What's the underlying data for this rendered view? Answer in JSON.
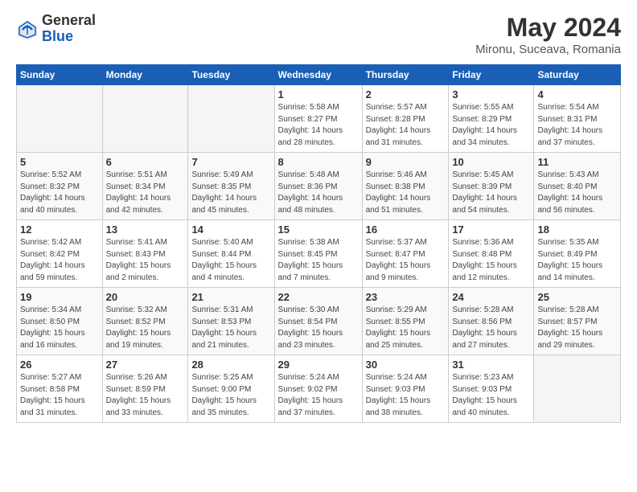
{
  "header": {
    "logo_general": "General",
    "logo_blue": "Blue",
    "month_year": "May 2024",
    "location": "Mironu, Suceava, Romania"
  },
  "days_of_week": [
    "Sunday",
    "Monday",
    "Tuesday",
    "Wednesday",
    "Thursday",
    "Friday",
    "Saturday"
  ],
  "weeks": [
    [
      {
        "day": "",
        "empty": true
      },
      {
        "day": "",
        "empty": true
      },
      {
        "day": "",
        "empty": true
      },
      {
        "day": "1",
        "info": "Sunrise: 5:58 AM\nSunset: 8:27 PM\nDaylight: 14 hours\nand 28 minutes."
      },
      {
        "day": "2",
        "info": "Sunrise: 5:57 AM\nSunset: 8:28 PM\nDaylight: 14 hours\nand 31 minutes."
      },
      {
        "day": "3",
        "info": "Sunrise: 5:55 AM\nSunset: 8:29 PM\nDaylight: 14 hours\nand 34 minutes."
      },
      {
        "day": "4",
        "info": "Sunrise: 5:54 AM\nSunset: 8:31 PM\nDaylight: 14 hours\nand 37 minutes."
      }
    ],
    [
      {
        "day": "5",
        "info": "Sunrise: 5:52 AM\nSunset: 8:32 PM\nDaylight: 14 hours\nand 40 minutes."
      },
      {
        "day": "6",
        "info": "Sunrise: 5:51 AM\nSunset: 8:34 PM\nDaylight: 14 hours\nand 42 minutes."
      },
      {
        "day": "7",
        "info": "Sunrise: 5:49 AM\nSunset: 8:35 PM\nDaylight: 14 hours\nand 45 minutes."
      },
      {
        "day": "8",
        "info": "Sunrise: 5:48 AM\nSunset: 8:36 PM\nDaylight: 14 hours\nand 48 minutes."
      },
      {
        "day": "9",
        "info": "Sunrise: 5:46 AM\nSunset: 8:38 PM\nDaylight: 14 hours\nand 51 minutes."
      },
      {
        "day": "10",
        "info": "Sunrise: 5:45 AM\nSunset: 8:39 PM\nDaylight: 14 hours\nand 54 minutes."
      },
      {
        "day": "11",
        "info": "Sunrise: 5:43 AM\nSunset: 8:40 PM\nDaylight: 14 hours\nand 56 minutes."
      }
    ],
    [
      {
        "day": "12",
        "info": "Sunrise: 5:42 AM\nSunset: 8:42 PM\nDaylight: 14 hours\nand 59 minutes."
      },
      {
        "day": "13",
        "info": "Sunrise: 5:41 AM\nSunset: 8:43 PM\nDaylight: 15 hours\nand 2 minutes."
      },
      {
        "day": "14",
        "info": "Sunrise: 5:40 AM\nSunset: 8:44 PM\nDaylight: 15 hours\nand 4 minutes."
      },
      {
        "day": "15",
        "info": "Sunrise: 5:38 AM\nSunset: 8:45 PM\nDaylight: 15 hours\nand 7 minutes."
      },
      {
        "day": "16",
        "info": "Sunrise: 5:37 AM\nSunset: 8:47 PM\nDaylight: 15 hours\nand 9 minutes."
      },
      {
        "day": "17",
        "info": "Sunrise: 5:36 AM\nSunset: 8:48 PM\nDaylight: 15 hours\nand 12 minutes."
      },
      {
        "day": "18",
        "info": "Sunrise: 5:35 AM\nSunset: 8:49 PM\nDaylight: 15 hours\nand 14 minutes."
      }
    ],
    [
      {
        "day": "19",
        "info": "Sunrise: 5:34 AM\nSunset: 8:50 PM\nDaylight: 15 hours\nand 16 minutes."
      },
      {
        "day": "20",
        "info": "Sunrise: 5:32 AM\nSunset: 8:52 PM\nDaylight: 15 hours\nand 19 minutes."
      },
      {
        "day": "21",
        "info": "Sunrise: 5:31 AM\nSunset: 8:53 PM\nDaylight: 15 hours\nand 21 minutes."
      },
      {
        "day": "22",
        "info": "Sunrise: 5:30 AM\nSunset: 8:54 PM\nDaylight: 15 hours\nand 23 minutes."
      },
      {
        "day": "23",
        "info": "Sunrise: 5:29 AM\nSunset: 8:55 PM\nDaylight: 15 hours\nand 25 minutes."
      },
      {
        "day": "24",
        "info": "Sunrise: 5:28 AM\nSunset: 8:56 PM\nDaylight: 15 hours\nand 27 minutes."
      },
      {
        "day": "25",
        "info": "Sunrise: 5:28 AM\nSunset: 8:57 PM\nDaylight: 15 hours\nand 29 minutes."
      }
    ],
    [
      {
        "day": "26",
        "info": "Sunrise: 5:27 AM\nSunset: 8:58 PM\nDaylight: 15 hours\nand 31 minutes."
      },
      {
        "day": "27",
        "info": "Sunrise: 5:26 AM\nSunset: 8:59 PM\nDaylight: 15 hours\nand 33 minutes."
      },
      {
        "day": "28",
        "info": "Sunrise: 5:25 AM\nSunset: 9:00 PM\nDaylight: 15 hours\nand 35 minutes."
      },
      {
        "day": "29",
        "info": "Sunrise: 5:24 AM\nSunset: 9:02 PM\nDaylight: 15 hours\nand 37 minutes."
      },
      {
        "day": "30",
        "info": "Sunrise: 5:24 AM\nSunset: 9:03 PM\nDaylight: 15 hours\nand 38 minutes."
      },
      {
        "day": "31",
        "info": "Sunrise: 5:23 AM\nSunset: 9:03 PM\nDaylight: 15 hours\nand 40 minutes."
      },
      {
        "day": "",
        "empty": true
      }
    ]
  ]
}
